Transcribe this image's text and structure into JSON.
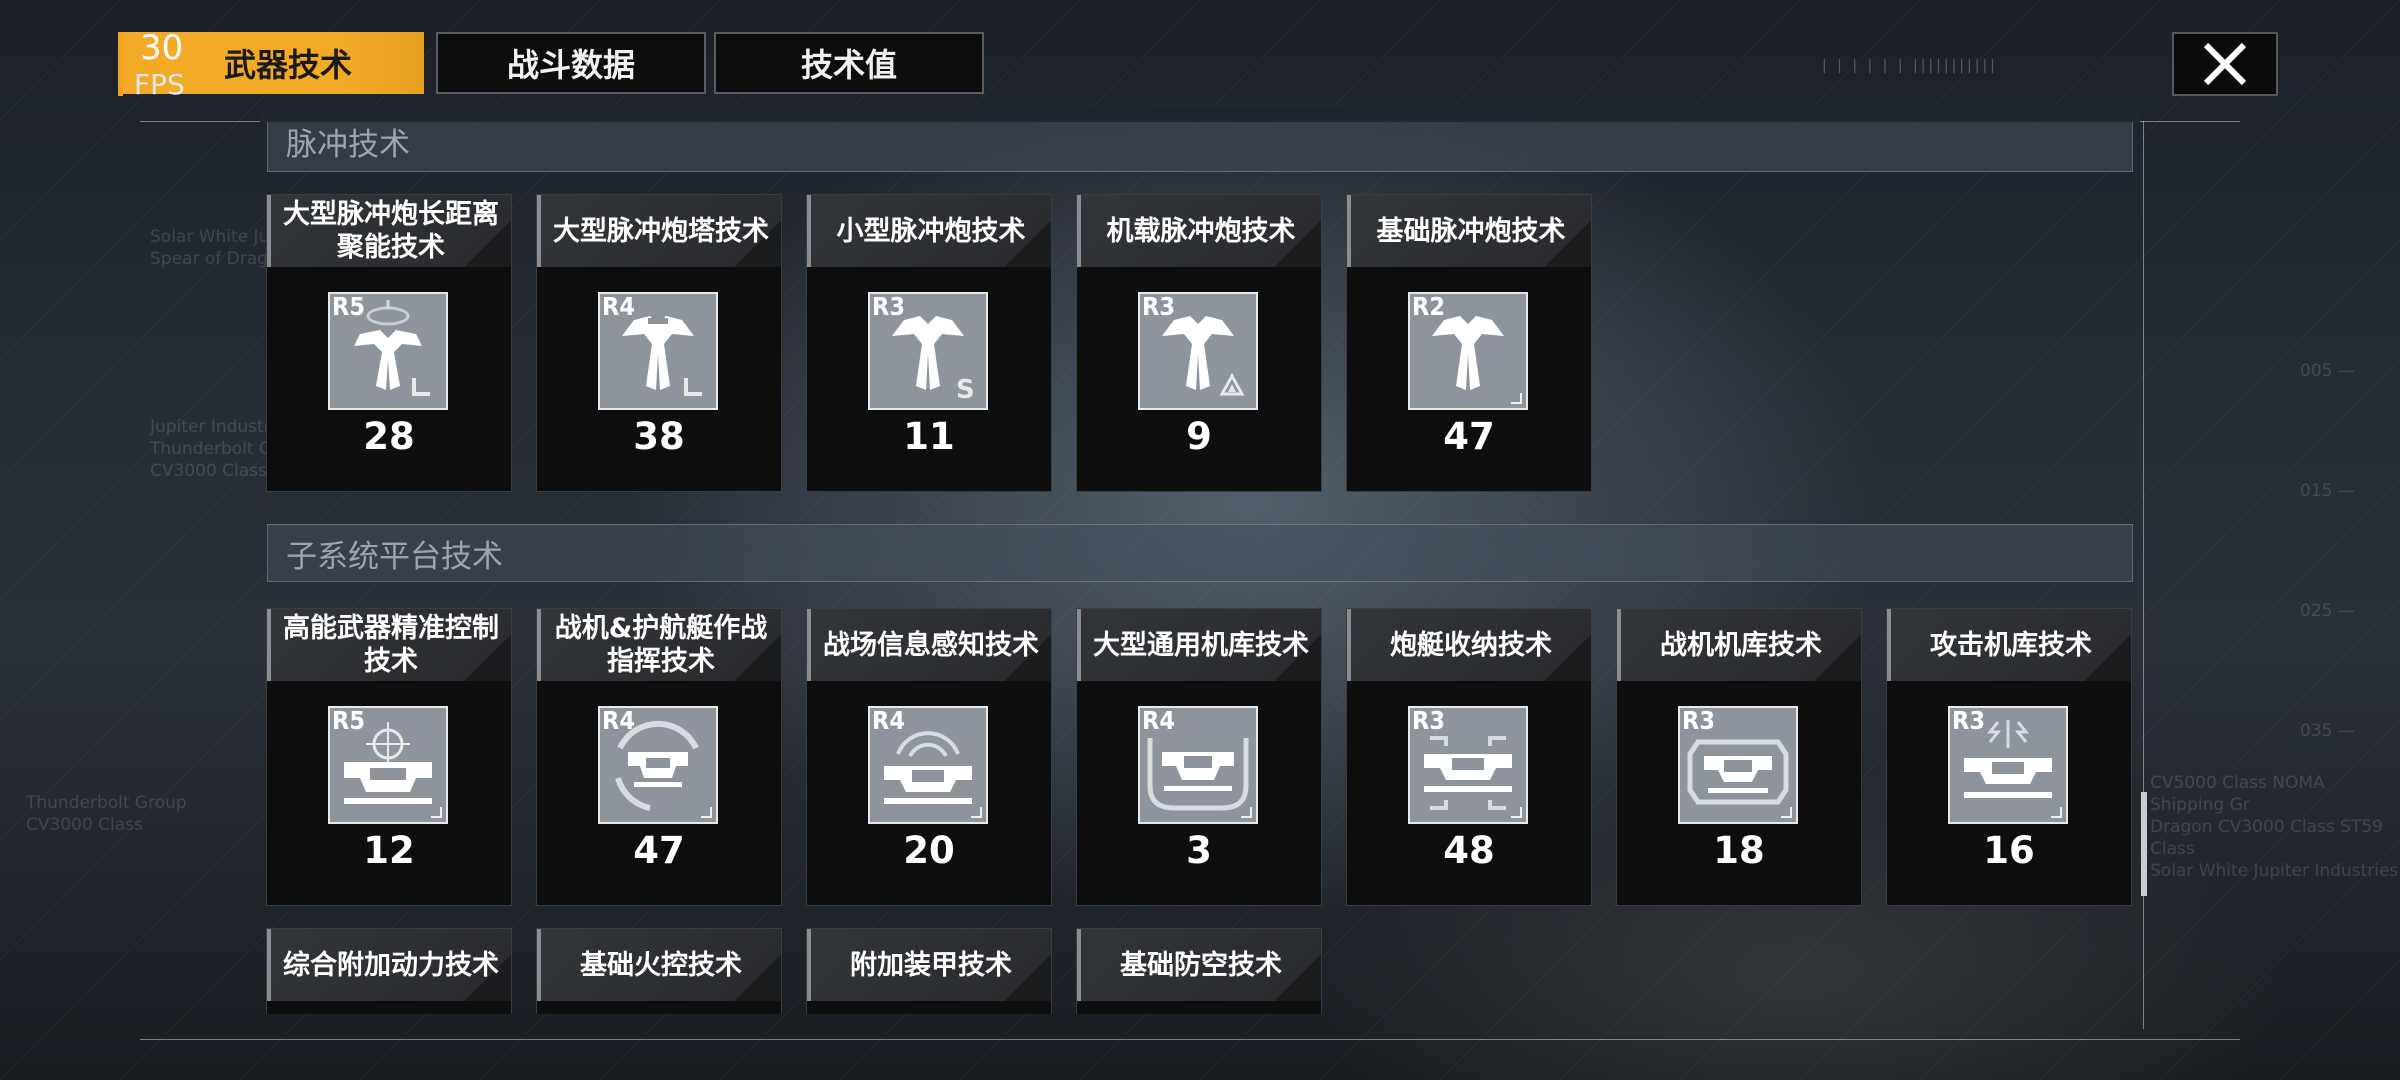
{
  "header": {
    "fps_value": "30",
    "fps_label": "FPS",
    "tabs": [
      {
        "label": "武器技术"
      },
      {
        "label": "战斗数据"
      },
      {
        "label": "技术值"
      }
    ]
  },
  "sections": [
    {
      "title": "脉冲技术",
      "items": [
        {
          "label": "大型脉冲炮长距离聚能技术",
          "rank": "R5",
          "value": "28",
          "icon": "large-pulse-cannon-icon"
        },
        {
          "label": "大型脉冲炮塔技术",
          "rank": "R4",
          "value": "38",
          "icon": "large-pulse-turret-icon"
        },
        {
          "label": "小型脉冲炮技术",
          "rank": "R3",
          "value": "11",
          "icon": "small-pulse-cannon-icon"
        },
        {
          "label": "机载脉冲炮技术",
          "rank": "R3",
          "value": "9",
          "icon": "aircraft-pulse-cannon-icon"
        },
        {
          "label": "基础脉冲炮技术",
          "rank": "R2",
          "value": "47",
          "icon": "basic-pulse-cannon-icon"
        }
      ]
    },
    {
      "title": "子系统平台技术",
      "items": [
        {
          "label": "高能武器精准控制技术",
          "rank": "R5",
          "value": "12",
          "icon": "precision-control-icon"
        },
        {
          "label": "战机&护航艇作战指挥技术",
          "rank": "R4",
          "value": "47",
          "icon": "command-ring-icon"
        },
        {
          "label": "战场信息感知技术",
          "rank": "R4",
          "value": "20",
          "icon": "radar-sensing-icon"
        },
        {
          "label": "大型通用机库技术",
          "rank": "R4",
          "value": "3",
          "icon": "hangar-icon"
        },
        {
          "label": "炮艇收纳技术",
          "rank": "R3",
          "value": "48",
          "icon": "gunboat-storage-icon"
        },
        {
          "label": "战机机库技术",
          "rank": "R3",
          "value": "18",
          "icon": "fighter-hangar-icon"
        },
        {
          "label": "攻击机库技术",
          "rank": "R3",
          "value": "16",
          "icon": "attack-hangar-icon"
        }
      ]
    }
  ],
  "partial_items": [
    {
      "label": "综合附加动力技术"
    },
    {
      "label": "基础火控技术"
    },
    {
      "label": "附加装甲技术"
    },
    {
      "label": "基础防空技术"
    }
  ],
  "colors": {
    "accent": "#f3aa27",
    "card_bg": "#0e0e0e",
    "icon_bg": "#8d949b"
  }
}
